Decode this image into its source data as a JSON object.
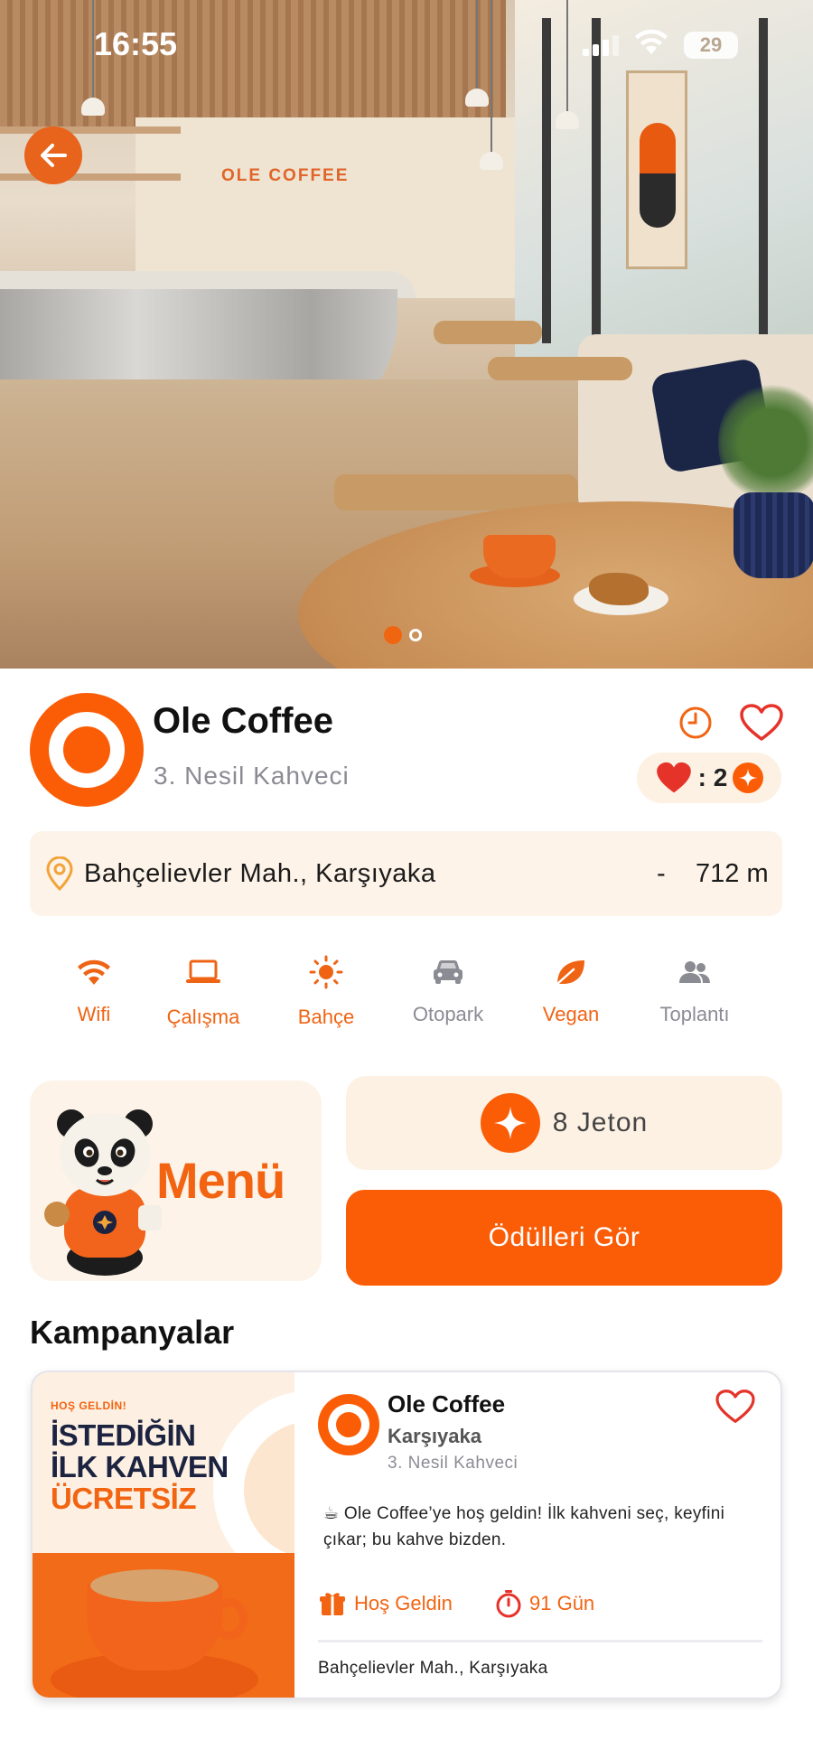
{
  "status_bar": {
    "time": "16:55",
    "battery": "29"
  },
  "hero": {
    "sign_text": "OLE COFFEE",
    "slide_count": 2,
    "active_slide": 1
  },
  "cafe": {
    "name": "Ole Coffee",
    "category": "3. Nesil Kahveci",
    "favorites_count": ": 2"
  },
  "address": {
    "text": "Bahçelievler Mah., Karşıyaka",
    "separator": "-",
    "distance": "712 m"
  },
  "amenities": [
    {
      "label": "Wifi",
      "icon": "wifi-icon",
      "active": true
    },
    {
      "label": "Çalışma",
      "icon": "laptop-icon",
      "active": true
    },
    {
      "label": "Bahçe",
      "icon": "sun-icon",
      "active": true
    },
    {
      "label": "Otopark",
      "icon": "car-icon",
      "active": false
    },
    {
      "label": "Vegan",
      "icon": "leaf-icon",
      "active": true
    },
    {
      "label": "Toplantı",
      "icon": "people-icon",
      "active": false
    }
  ],
  "menu": {
    "label": "Menü"
  },
  "jeton": {
    "label": "8 Jeton"
  },
  "rewards_button": "Ödülleri Gör",
  "campaigns": {
    "title": "Kampanyalar",
    "items": [
      {
        "image_small": "HOŞ GELDİN!",
        "image_line1": "İSTEDİĞİN",
        "image_line2": "İLK KAHVEN",
        "image_line3": "ÜCRETSİZ",
        "name": "Ole Coffee",
        "district": "Karşıyaka",
        "category": "3. Nesil Kahveci",
        "description": "☕ Ole Coffee’ye hoş geldin! İlk kahveni seç, keyfini çıkar; bu kahve bizden.",
        "tag": "Hoş Geldin",
        "days": "91 Gün",
        "address": "Bahçelievler Mah., Karşıyaka"
      }
    ]
  },
  "colors": {
    "accent": "#fb5d07",
    "accent_text": "#f26411",
    "soft_bg": "#fdf3e8",
    "muted": "#8b8b94",
    "heart": "#e5332a"
  }
}
